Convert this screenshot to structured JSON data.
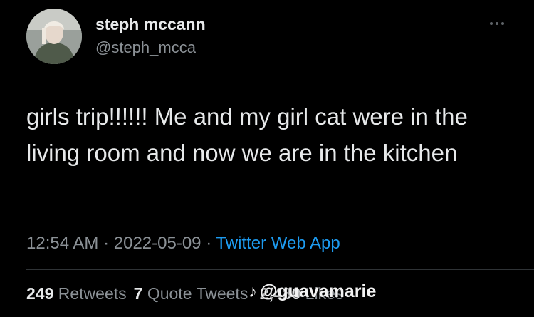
{
  "user": {
    "name": "steph mccann",
    "handle": "@steph_mcca"
  },
  "tweet": {
    "text": "girls trip!!!!!! Me and my girl cat were in the living room and now we are in the kitchen",
    "time": "12:54 AM",
    "date": "2022-05-09",
    "source": "Twitter Web App",
    "separator": "·"
  },
  "stats": {
    "retweets_count": "249",
    "retweets_label": "Retweets",
    "quotes_count": "7",
    "quotes_label": "Quote Tweets",
    "likes_count": "2,480",
    "likes_label": "Likes"
  },
  "watermark": {
    "text": "@guavamarie",
    "icon": "tiktok-icon"
  },
  "colors": {
    "background": "#000000",
    "text": "#e7e9ea",
    "secondary": "#8b9196",
    "link": "#1d9bf0"
  }
}
